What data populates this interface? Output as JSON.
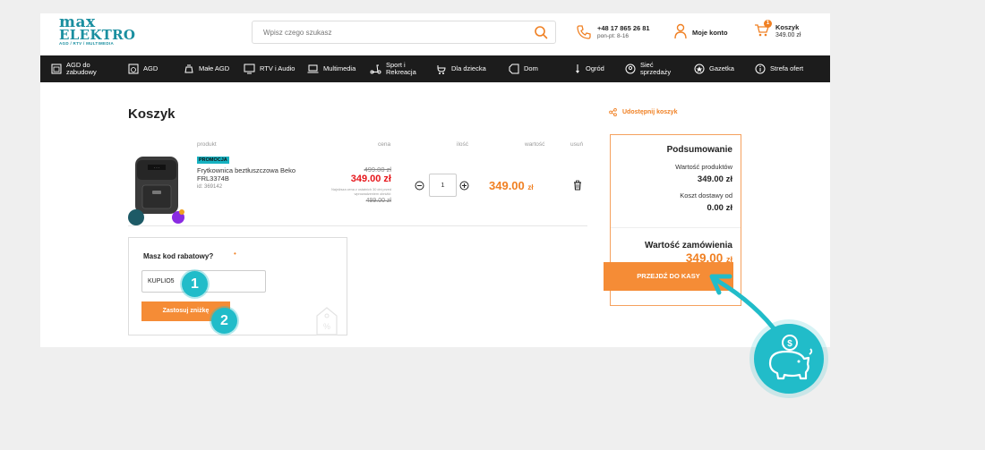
{
  "logo": {
    "line1": "max",
    "line2": "ELEKTRO",
    "line3": "AGD / RTV / MULTIMEDIA"
  },
  "search": {
    "placeholder": "Wpisz czego szukasz"
  },
  "phone": {
    "number": "+48 17 865 26 81",
    "hours": "pon-pt: 8-16"
  },
  "account": {
    "label": "Moje konto"
  },
  "cart_header": {
    "label": "Koszyk",
    "amount": "349.00 zł",
    "badge": "1"
  },
  "nav": [
    {
      "label": "AGD do zabudowy",
      "icon": "built-in-appliance-icon"
    },
    {
      "label": "AGD",
      "icon": "washing-machine-icon"
    },
    {
      "label": "Małe AGD",
      "icon": "kettle-icon"
    },
    {
      "label": "RTV i Audio",
      "icon": "tv-icon"
    },
    {
      "label": "Multimedia",
      "icon": "laptop-icon"
    },
    {
      "label": "Sport i Rekreacja",
      "icon": "scooter-icon"
    },
    {
      "label": "Dla dziecka",
      "icon": "stroller-icon"
    },
    {
      "label": "Dom",
      "icon": "tag-icon"
    },
    {
      "label": "Ogród",
      "icon": "garden-tool-icon"
    },
    {
      "label": "Sieć sprzedaży",
      "icon": "location-icon"
    },
    {
      "label": "Gazetka",
      "icon": "star-icon"
    },
    {
      "label": "Strefa ofert",
      "icon": "info-icon"
    }
  ],
  "cart": {
    "title": "Koszyk",
    "columns": {
      "product": "produkt",
      "price": "cena",
      "qty": "ilość",
      "value": "wartość",
      "remove": "usuń"
    },
    "item": {
      "badge": "PROMOCJA",
      "name": "Frytkownica beztłuszczowa Beko FRL3374B",
      "id": "id: 369142",
      "old_price": "499.00 zł",
      "price": "349.00 zł",
      "lowest_note": "Najniższa cena z ostatnich 30 dni przed wprowadzeniem obniżki:",
      "lowest_price": "499.00 zł",
      "qty": "1",
      "value_amount": "349.00",
      "value_currency": "zł"
    }
  },
  "discount": {
    "title": "Masz kod rabatowy?",
    "dot": "•",
    "code": "KUPLIO5",
    "apply_label": "Zastosuj zniżkę",
    "step1": "1",
    "step2": "2"
  },
  "share": {
    "label": "Udostępnij koszyk"
  },
  "summary": {
    "title": "Podsumowanie",
    "products_label": "Wartość produktów",
    "products_value": "349.00 zł",
    "shipping_label": "Koszt dostawy od",
    "shipping_value": "0.00 zł",
    "total_label": "Wartość zamówienia",
    "total_amount": "349.00",
    "total_currency": "zł",
    "checkout_label": "PRZEJDŹ DO KASY"
  },
  "colors": {
    "accent": "#f08023",
    "teal": "#21bcc9",
    "price_red": "#e6161b"
  }
}
